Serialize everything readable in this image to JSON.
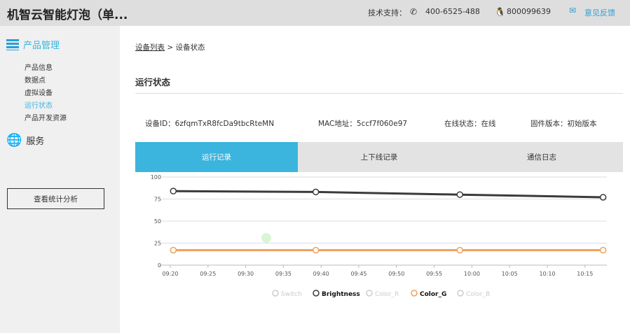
{
  "header": {
    "title": "机智云智能灯泡（单...",
    "support_label": "技术支持：",
    "phone": "400-6525-488",
    "qq": "800099639",
    "feedback": "意见反馈"
  },
  "sidebar": {
    "section1": "产品管理",
    "items": [
      {
        "label": "产品信息"
      },
      {
        "label": "数据点"
      },
      {
        "label": "虚拟设备"
      },
      {
        "label": "运行状态",
        "active": true
      },
      {
        "label": "产品开发资源"
      }
    ],
    "section2": "服务",
    "stats_button": "查看统计分析"
  },
  "breadcrumb": {
    "parent": "设备列表",
    "separator": ">",
    "current": "设备状态"
  },
  "page_title": "运行状态",
  "device": {
    "id": "设备ID：6zfqmTxR8fcDa9tbcRteMN",
    "mac": "MAC地址：5ccf7f060e97",
    "online": "在线状态：在线",
    "firmware": "固件版本：初始版本"
  },
  "tabs": [
    {
      "label": "运行记录",
      "active": true
    },
    {
      "label": "上下线记录"
    },
    {
      "label": "通信日志"
    }
  ],
  "colors": {
    "accent": "#3bb5de",
    "brightness": "#3a3a3e",
    "color_g": "#f0a05a",
    "inactive": "#cccccc"
  },
  "chart_data": {
    "type": "line",
    "ylim": [
      0,
      100
    ],
    "yticks": [
      "0",
      "25",
      "50",
      "75",
      "100"
    ],
    "xticks": [
      "09:20",
      "09:25",
      "09:30",
      "09:35",
      "09:40",
      "09:45",
      "09:50",
      "09:55",
      "10:00",
      "10:05",
      "10:10",
      "10:15"
    ],
    "x_minutes": [
      560.4,
      579.3,
      598.4,
      617.4
    ],
    "series": [
      {
        "name": "Switch",
        "visible": false,
        "values": []
      },
      {
        "name": "Brightness",
        "visible": true,
        "values": [
          84,
          83,
          80,
          77
        ]
      },
      {
        "name": "Color_R",
        "visible": false,
        "values": []
      },
      {
        "name": "Color_G",
        "visible": true,
        "values": [
          17,
          17,
          17,
          17
        ]
      },
      {
        "name": "Color_B",
        "visible": false,
        "values": []
      }
    ],
    "legend_position": "bottom"
  }
}
